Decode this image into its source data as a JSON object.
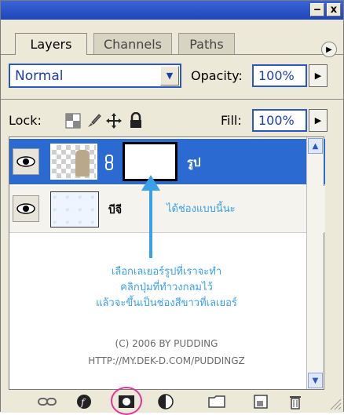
{
  "window": {
    "minimize_label": "‒",
    "close_label": "x",
    "title_bar_color": "#2f59cf"
  },
  "tabs": [
    {
      "label": "Layers",
      "active": true
    },
    {
      "label": "Channels",
      "active": false
    },
    {
      "label": "Paths",
      "active": false
    }
  ],
  "blend": {
    "mode": "Normal"
  },
  "opacity": {
    "label": "Opacity:",
    "value": "100%"
  },
  "lock": {
    "label": "Lock:",
    "icons": [
      "transparency-lock-icon",
      "brush-lock-icon",
      "move-lock-icon",
      "padlock-icon"
    ]
  },
  "fill": {
    "label": "Fill:",
    "value": "100%"
  },
  "layers": [
    {
      "name": "รูป",
      "selected": true,
      "has_mask": true,
      "visible": true
    },
    {
      "name": "บีจี",
      "selected": false,
      "has_mask": false,
      "visible": true
    }
  ],
  "annotations": {
    "mask_note": "ได้ช่องแบบนี้นะ",
    "instruction_line1": "เลือกเลเยอร์รูปที่เราจะทำ",
    "instruction_line2": "คลิกปุ่มที่ทำวงกลมไว้",
    "instruction_line3": "แล้วจะขึ้นเป็นช่องสีขาวที่เลเยอร์",
    "credit": "(C) 2006 BY PUDDING",
    "url": "HTTP://MY.DEK-D.COM/PUDDINGZ",
    "color": "#3aa0e8"
  },
  "bottom_icons": [
    "link-layers-icon",
    "layer-style-icon",
    "add-layer-mask-icon",
    "adjustment-layer-icon",
    "new-group-icon",
    "new-layer-icon",
    "delete-layer-icon"
  ],
  "colors": {
    "accent": "#2b57c5",
    "selected_row": "#2b6ad1",
    "highlight_circle": "#e0349a"
  }
}
